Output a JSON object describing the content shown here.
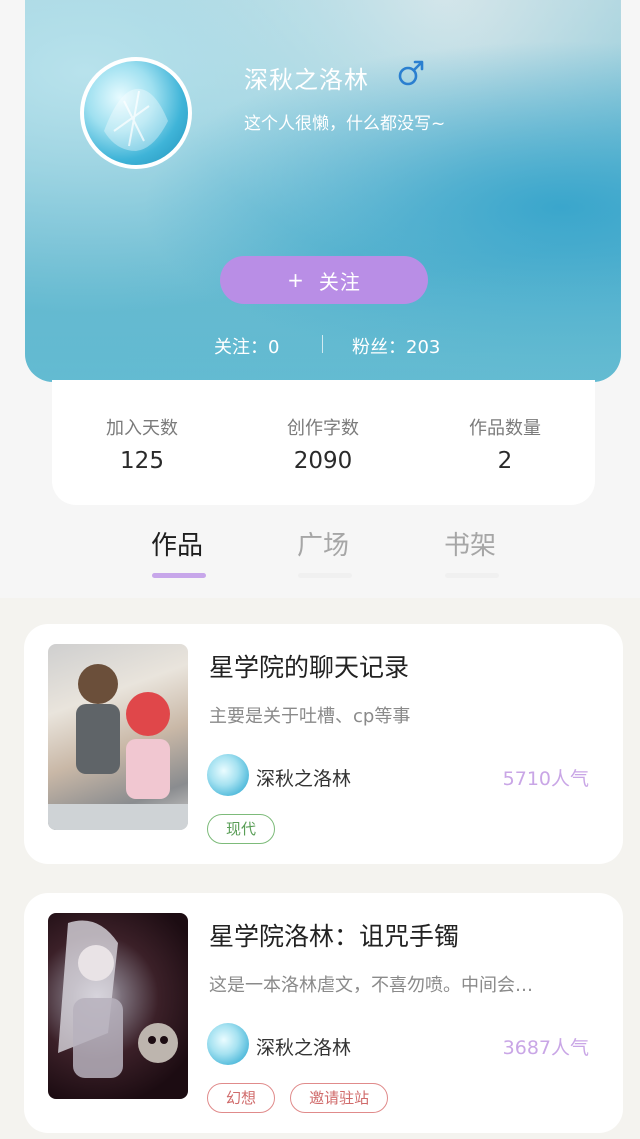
{
  "profile": {
    "name": "深秋之洛林",
    "gender_icon": "male-symbol-icon",
    "bio": "这个人很懒，什么都没写~",
    "follow_button": {
      "plus": "+",
      "label": "关注"
    },
    "following_text": "关注：0",
    "followers_text": "粉丝：203"
  },
  "stats": [
    {
      "label": "加入天数",
      "value": "125"
    },
    {
      "label": "创作字数",
      "value": "2090"
    },
    {
      "label": "作品数量",
      "value": "2"
    }
  ],
  "tabs": [
    {
      "label": "作品",
      "active": true
    },
    {
      "label": "广场",
      "active": false
    },
    {
      "label": "书架",
      "active": false
    }
  ],
  "works": [
    {
      "title": "星学院的聊天记录",
      "description": "主要是关于吐槽、cp等事",
      "author": "深秋之洛林",
      "popularity": "5710人气",
      "tags": [
        "现代"
      ]
    },
    {
      "title": "星学院洛林：诅咒手镯",
      "description": "这是一本洛林虐文，不喜勿喷。中间会…",
      "author": "深秋之洛林",
      "popularity": "3687人气",
      "tags": [
        "幻想",
        "邀请驻站"
      ]
    }
  ],
  "colors": {
    "accent_purple": "#b98ee6",
    "popularity_text": "#c9a6e6",
    "tag_green": "#5a9e57",
    "tag_red": "#d06b6b",
    "header_blue": "#58b4cc"
  }
}
